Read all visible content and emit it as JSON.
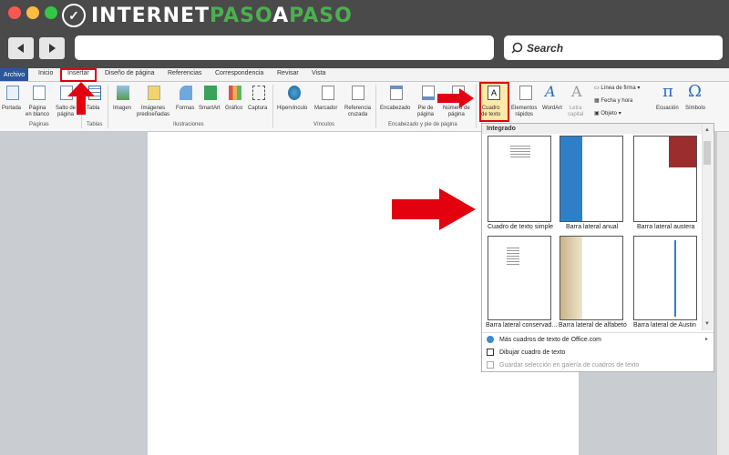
{
  "brand": {
    "name": "INTERNETPASOAPASO",
    "accent": "#4caf50"
  },
  "browser": {
    "search_placeholder": "Search"
  },
  "ribbon_tabs": [
    "Archivo",
    "Inicio",
    "Insertar",
    "Diseño de página",
    "Referencias",
    "Correspondencia",
    "Revisar",
    "Vista"
  ],
  "ribbon": {
    "portada": "Portada",
    "pagina_blanco_1": "Página",
    "pagina_blanco_2": "en blanco",
    "salto_1": "Salto de",
    "salto_2": "página",
    "tabla": "Tabla",
    "imagen": "Imagen",
    "imagenes_1": "Imágenes",
    "imagenes_2": "prediseñadas",
    "formas": "Formas",
    "smartart": "SmartArt",
    "grafico": "Gráfico",
    "captura": "Captura",
    "hipervinculo": "Hipervínculo",
    "marcador": "Marcador",
    "referencia_1": "Referencia",
    "referencia_2": "cruzada",
    "encabezado": "Encabezado",
    "pie_1": "Pie de",
    "pie_2": "página",
    "numero_1": "Número de",
    "numero_2": "página",
    "cuadro_1": "Cuadro",
    "cuadro_2": "de texto",
    "elementos_1": "Elementos",
    "elementos_2": "rápidos",
    "wordart": "WordArt",
    "letra_1": "Letra",
    "letra_2": "capital",
    "linea_firma": "Línea de firma",
    "fecha_hora": "Fecha y hora",
    "objeto": "Objeto",
    "ecuacion": "Ecuación",
    "simbolo": "Símbolo"
  },
  "groups": [
    "Páginas",
    "Tablas",
    "Ilustraciones",
    "Vínculos",
    "Encabezado y pie de página"
  ],
  "panel": {
    "header": "Integrado",
    "thumbnails": [
      "Cuadro de texto simple",
      "Barra lateral anual",
      "Barra lateral austera",
      "Barra lateral conservad...",
      "Barra lateral de alfabeto",
      "Barra lateral de Austin"
    ],
    "menu": [
      "Más cuadros de texto de Office.com",
      "Dibujar cuadro de texto",
      "Guardar selección en galería de cuadros de texto"
    ]
  },
  "colors": {
    "highlight": "#e3000f",
    "file_tab": "#2b579a",
    "sidebar_blue": "#2f7fc8",
    "sidebar_red": "#9b2d2d",
    "sidebar_tan": "#d9c9a8"
  }
}
